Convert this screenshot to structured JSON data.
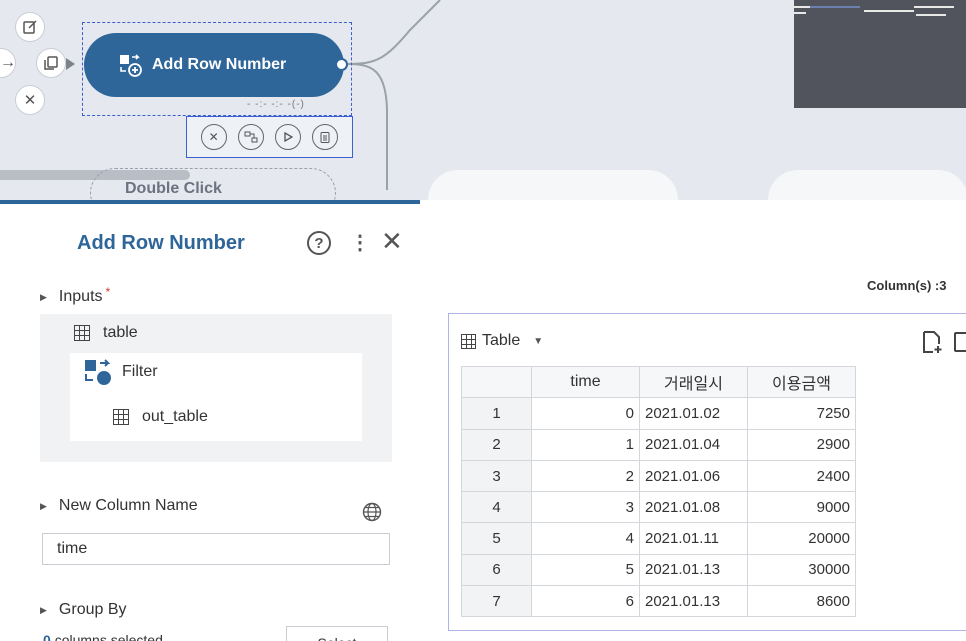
{
  "canvas": {
    "node_label": "Add Row Number",
    "node_time": "- -:- -:- -(-)",
    "ghost_node_label": "Double Click"
  },
  "panel": {
    "title": "Add Row Number",
    "help_glyph": "?",
    "more_glyph": "⋮",
    "close_glyph": "✕",
    "inputs_label": "Inputs",
    "required_mark": "*",
    "input_table": "table",
    "filter_label": "Filter",
    "out_table": "out_table",
    "new_column_label": "New Column Name",
    "new_column_value": "time",
    "group_by_label": "Group By",
    "columns_selected_count": "0",
    "columns_selected_text": "columns selected",
    "select_button": "Select"
  },
  "output": {
    "column_count": "Column(s) :3",
    "view_label": "Table",
    "columns": [
      "",
      "time",
      "거래일시",
      "이용금액"
    ],
    "rows": [
      [
        "1",
        "0",
        "2021.01.02",
        "7250"
      ],
      [
        "2",
        "1",
        "2021.01.04",
        "2900"
      ],
      [
        "3",
        "2",
        "2021.01.06",
        "2400"
      ],
      [
        "4",
        "3",
        "2021.01.08",
        "9000"
      ],
      [
        "5",
        "4",
        "2021.01.11",
        "20000"
      ],
      [
        "6",
        "5",
        "2021.01.13",
        "30000"
      ],
      [
        "7",
        "6",
        "2021.01.13",
        "8600"
      ]
    ]
  },
  "colors": {
    "accent": "#2f6699",
    "required": "#d9322b",
    "selection": "#3b5fcf"
  }
}
